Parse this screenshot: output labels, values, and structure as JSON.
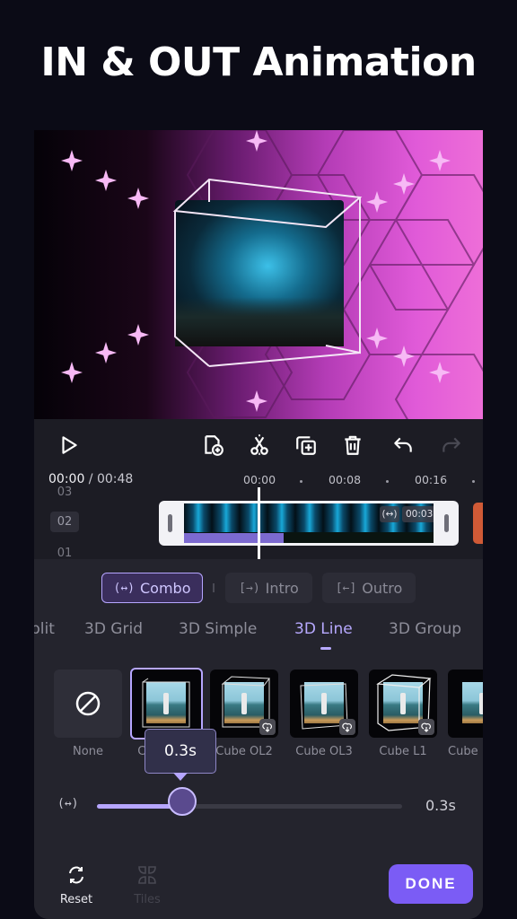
{
  "headline": "IN & OUT Animation",
  "colors": {
    "accent": "#b6a6ff",
    "done_button": "#7b5cf5",
    "panel_bg": "#24242d",
    "next_clip": "#d05a36"
  },
  "toolbar": {
    "play_icon": "play-icon",
    "icons": [
      "add-clip-icon",
      "split-icon",
      "duplicate-icon",
      "delete-icon",
      "undo-icon",
      "redo-icon"
    ]
  },
  "timeline": {
    "current_time": "00:00",
    "separator": " / ",
    "total_time": "00:48",
    "ruler_ticks": [
      "00:00",
      "00:08",
      "00:16"
    ],
    "tracks": [
      "03",
      "02",
      "01"
    ],
    "selected_track": "02",
    "clip": {
      "duration": "00:03",
      "transition_icon": "combo-transition-icon",
      "animation_progress": 0.4
    }
  },
  "animation_modes": [
    {
      "label": "Combo",
      "icon": "(↔)",
      "active": true
    },
    {
      "label": "Intro",
      "icon": "[→)",
      "active": false
    },
    {
      "label": "Outro",
      "icon": "[←]",
      "active": false
    }
  ],
  "categories": [
    {
      "label": "plit",
      "active": false
    },
    {
      "label": "3D Grid",
      "active": false
    },
    {
      "label": "3D Simple",
      "active": false
    },
    {
      "label": "3D Line",
      "active": true
    },
    {
      "label": "3D Group",
      "active": false
    }
  ],
  "presets": [
    {
      "label": "None",
      "type": "none",
      "selected": false,
      "downloadable": false
    },
    {
      "label": "Cube OL1",
      "type": "cube",
      "selected": true,
      "downloadable": false
    },
    {
      "label": "Cube OL2",
      "type": "cube",
      "selected": false,
      "downloadable": true
    },
    {
      "label": "Cube OL3",
      "type": "cube",
      "selected": false,
      "downloadable": true
    },
    {
      "label": "Cube L1",
      "type": "cube",
      "selected": false,
      "downloadable": true
    },
    {
      "label": "Cube",
      "type": "cube",
      "selected": false,
      "downloadable": false
    }
  ],
  "duration": {
    "tooltip": "0.3s",
    "value_label": "0.3s",
    "slider_fraction": 0.28
  },
  "bottom_bar": {
    "reset_label": "Reset",
    "tiles_label": "Tiles",
    "done_label": "DONE"
  }
}
